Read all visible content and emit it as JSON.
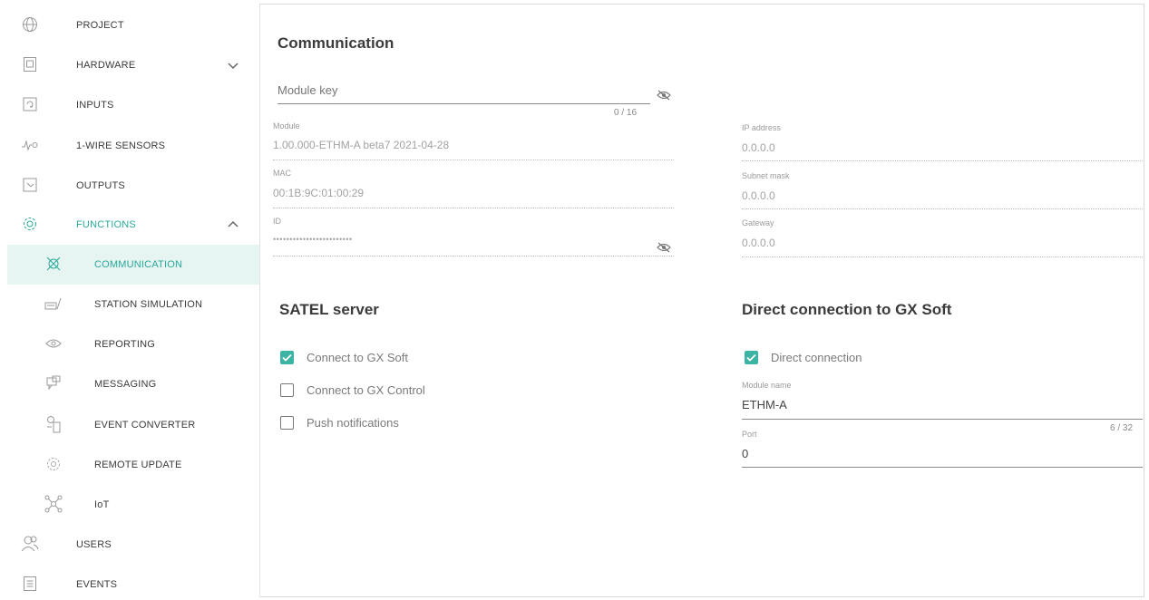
{
  "sidebar": {
    "items": [
      {
        "label": "PROJECT",
        "icon": "globe-icon"
      },
      {
        "label": "HARDWARE",
        "icon": "hardware-icon"
      },
      {
        "label": "INPUTS",
        "icon": "inputs-icon"
      },
      {
        "label": "1-WIRE SENSORS",
        "icon": "sensor-icon"
      },
      {
        "label": "OUTPUTS",
        "icon": "outputs-icon"
      },
      {
        "label": "FUNCTIONS",
        "icon": "gear-icon"
      },
      {
        "label": "COMMUNICATION",
        "icon": "communication-icon"
      },
      {
        "label": "STATION SIMULATION",
        "icon": "station-icon"
      },
      {
        "label": "REPORTING",
        "icon": "eye-icon"
      },
      {
        "label": "MESSAGING",
        "icon": "chat-icon"
      },
      {
        "label": "EVENT CONVERTER",
        "icon": "converter-icon"
      },
      {
        "label": "REMOTE UPDATE",
        "icon": "update-icon"
      },
      {
        "label": "IoT",
        "icon": "iot-icon"
      },
      {
        "label": "USERS",
        "icon": "users-icon"
      },
      {
        "label": "EVENTS",
        "icon": "events-icon"
      }
    ],
    "accent_color": "#2aa89a",
    "selected_bg": "#e6f4f2"
  },
  "communication": {
    "title": "Communication",
    "module_key": {
      "placeholder": "Module key",
      "counter": "0 / 16"
    },
    "module": {
      "label": "Module",
      "value": "1.00.000-ETHM-A  beta7 2021-04-28"
    },
    "mac": {
      "label": "MAC",
      "value": "00:1B:9C:01:00:29"
    },
    "id": {
      "label": "ID",
      "value": "••••••••••••••••••••••••"
    },
    "ip_address": {
      "label": "IP address",
      "value": "0.0.0.0"
    },
    "subnet_mask": {
      "label": "Subnet mask",
      "value": "0.0.0.0"
    },
    "gateway": {
      "label": "Gateway",
      "value": "0.0.0.0"
    }
  },
  "satel_server": {
    "title": "SATEL server",
    "options": [
      {
        "label": "Connect to GX Soft",
        "checked": true
      },
      {
        "label": "Connect to GX Control",
        "checked": false
      },
      {
        "label": "Push notifications",
        "checked": false
      }
    ]
  },
  "direct_connection": {
    "title": "Direct connection to GX Soft",
    "checkbox": {
      "label": "Direct connection",
      "checked": true
    },
    "module_name": {
      "label": "Module name",
      "value": "ETHM-A",
      "counter": "6 / 32"
    },
    "port": {
      "label": "Port",
      "value": "0"
    }
  }
}
